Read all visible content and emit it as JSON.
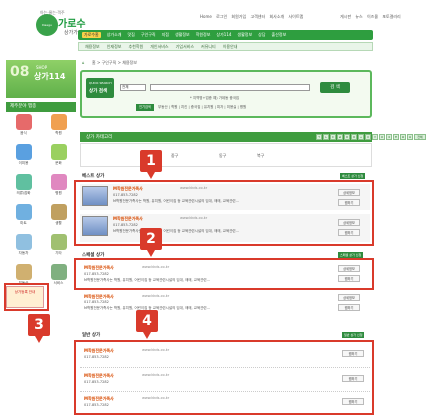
{
  "header": {
    "logo_tagline": "아는·물는·객주",
    "logo_main": "가로수",
    "logo_sub": "상가가이드",
    "top_links": [
      "Home",
      "로그인",
      "회원가입",
      "고객센터",
      "회사소개",
      "사이트맵"
    ],
    "top_links_right": [
      "게시판",
      "뉴스",
      "이즈몰",
      "포토갤러리"
    ]
  },
  "nav_primary": [
    "가로수홈",
    "상가소개",
    "맛집",
    "구인구직",
    "지점",
    "생활정보",
    "학원정보",
    "상가114",
    "생활정보",
    "상담",
    "출산정보"
  ],
  "nav_secondary": [
    "채용정보",
    "인재정보",
    "추천학원",
    "개인서비스",
    "기업서비스",
    "커뮤니티",
    "이용안내"
  ],
  "sidebar": {
    "shop_number": "08",
    "shop_label": "SHOP",
    "shop_title": "상가114",
    "category_title": "제주분야 맵종",
    "categories": [
      {
        "label": "음식",
        "color": "#e66a6a"
      },
      {
        "label": "학원",
        "color": "#f0a050"
      },
      {
        "label": "이미용",
        "color": "#5aa0e0"
      },
      {
        "label": "문화",
        "color": "#9ad060"
      },
      {
        "label": "의류/잡화",
        "color": "#60c0a0"
      },
      {
        "label": "병원",
        "color": "#e088c0"
      },
      {
        "label": "마트",
        "color": "#70b0e0"
      },
      {
        "label": "생활",
        "color": "#c0a060"
      },
      {
        "label": "자동차",
        "color": "#90c0e0"
      },
      {
        "label": "기타",
        "color": "#a0c070"
      },
      {
        "label": "부동산",
        "color": "#d0b070"
      },
      {
        "label": "서비스",
        "color": "#80b080"
      }
    ],
    "ad_text": "상가등록 안내"
  },
  "breadcrumb": "홈 > 구인구직 > 채용정보",
  "search": {
    "quick_label": "QUICK SEARCH",
    "title": "상가 검색",
    "select_value": "전체",
    "button": "검 색",
    "hint": "* 지역명+업종 예) 가데동 중국집",
    "tag": "인기검색",
    "popular": "부동산 | 학원 | 치킨 | 중국집 | 유치원 | 피자 | 미용실 | 병원"
  },
  "category_bar": {
    "label": "상가 카테고리",
    "letters": [
      "ㄱ",
      "ㄴ",
      "ㄷ",
      "ㄹ",
      "ㅁ",
      "ㅂ",
      "ㅅ",
      "ㅇ",
      "ㅈ",
      "ㅊ",
      "ㅋ",
      "ㅌ",
      "ㅍ",
      "ㅎ",
      "전체"
    ]
  },
  "regions": [
    "중구",
    "동구",
    "북구"
  ],
  "sections": {
    "best": {
      "title": "베스트 상가",
      "tag": "베스트 상가 신청",
      "items": [
        {
          "name": "M학원전문가족사",
          "url": "www.kkds.co.kr",
          "tel": "017-853-7282",
          "desc": "M학원전문가족사는 학원, 유치원, 어린이집 등 교육관련시설의 임대, 매매, 교육관련...",
          "btn1": "상세정보",
          "btn2": "찜하기"
        },
        {
          "name": "M학원전문가족사",
          "url": "www.kkds.co.kr",
          "tel": "017-853-7282",
          "desc": "M학원전문가족사는 학원, 유치원, 어린이집 등 교육관련시설의 임대, 매매, 교육관련...",
          "btn1": "상세정보",
          "btn2": "찜하기"
        }
      ]
    },
    "smart": {
      "title": "스페셜 상가",
      "tag": "스페셜 상가 신청",
      "items": [
        {
          "name": "M학원전문가족사",
          "url": "www.kkds.co.kr",
          "tel": "017-853-7282",
          "desc": "M학원전문가족사는 학원, 유치원, 어린이집 등 교육관련시설의 임대, 매매, 교육관련...",
          "btn1": "상세정보",
          "btn2": "찜하기"
        },
        {
          "name": "M학원전문가족사",
          "url": "www.kkds.co.kr",
          "tel": "017-853-7282",
          "desc": "M학원전문가족사는 학원, 유치원, 어린이집 등 교육관련시설의 임대, 매매, 교육관련...",
          "btn1": "상세정보",
          "btn2": "찜하기"
        }
      ]
    },
    "general": {
      "title": "일반 상가",
      "tag": "일반 상가 신청",
      "items": [
        {
          "name": "M학원전문가족사",
          "url": "www.kkds.co.kr",
          "tel": "017-853-7282",
          "btn": "찜하기"
        },
        {
          "name": "M학원전문가족사",
          "url": "www.kkds.co.kr",
          "tel": "017-853-7282",
          "btn": "찜하기"
        },
        {
          "name": "M학원전문가족사",
          "url": "www.kkds.co.kr",
          "tel": "017-853-7282",
          "btn": "찜하기"
        }
      ]
    }
  },
  "annotations": [
    "1",
    "2",
    "3",
    "4"
  ],
  "colors": {
    "primary_green": "#2e9e3f",
    "highlight_red": "#d93a2b",
    "name_orange": "#d84a00"
  }
}
